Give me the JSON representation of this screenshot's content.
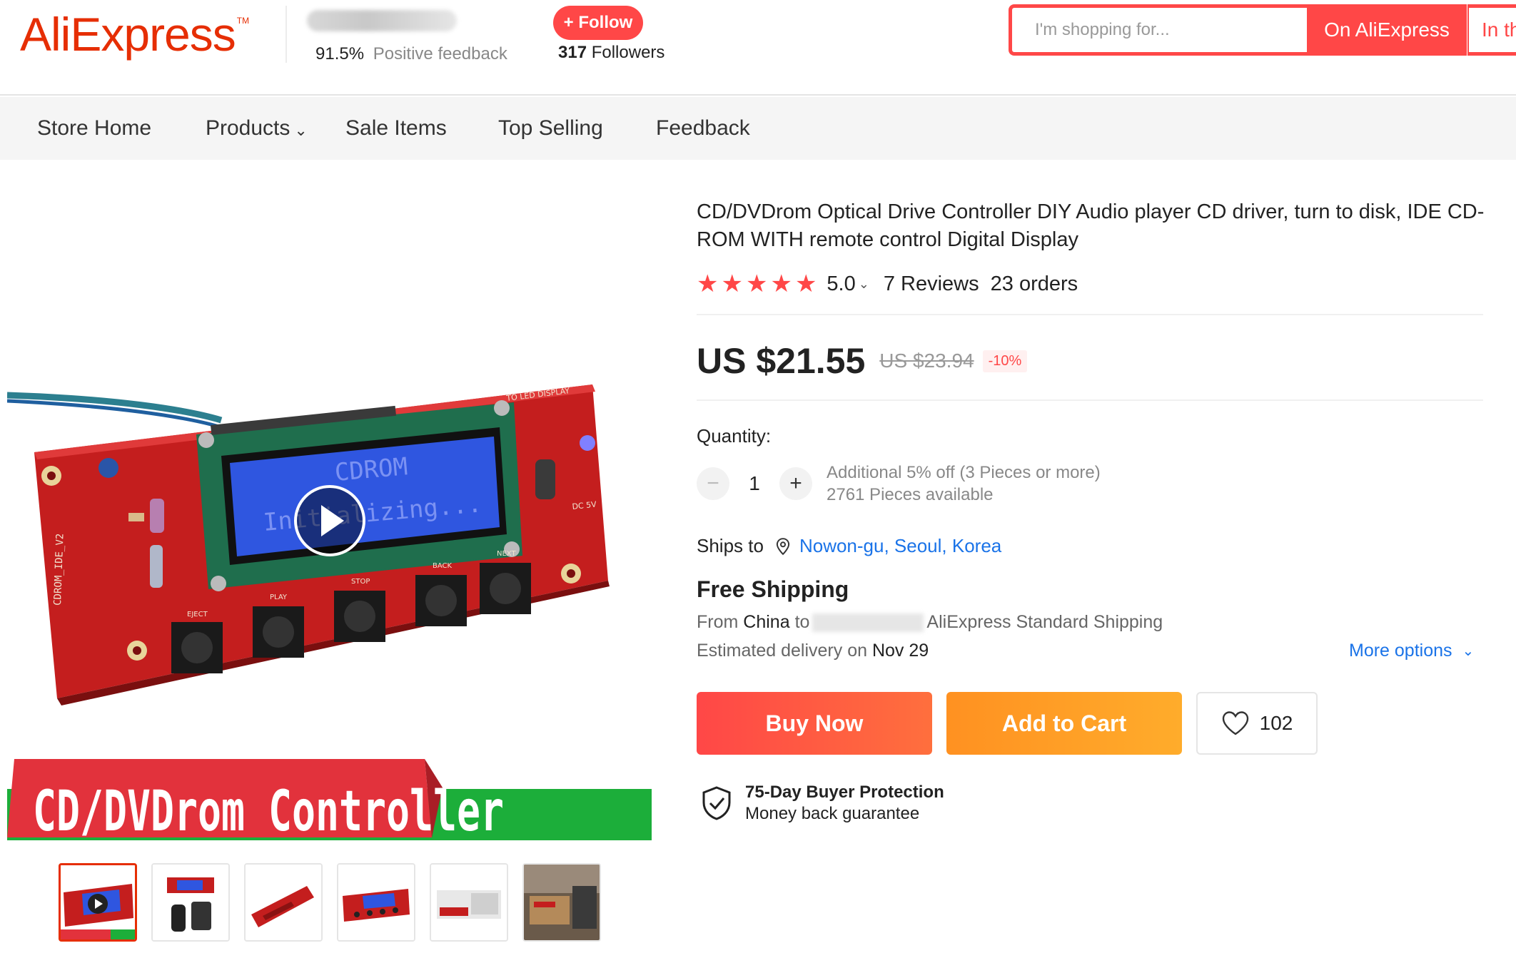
{
  "header": {
    "logo": "AliExpress",
    "logo_tm": "TM",
    "store": {
      "feedback_pct": "91.5%",
      "feedback_label": "Positive feedback",
      "follow_label": "+ Follow",
      "followers_count": "317",
      "followers_label": "Followers"
    },
    "search": {
      "placeholder": "I'm shopping for...",
      "button_label": "On AliExpress",
      "button2_label": "In this store"
    }
  },
  "nav": {
    "items": [
      {
        "label": "Store Home"
      },
      {
        "label": "Products"
      },
      {
        "label": "Sale Items"
      },
      {
        "label": "Top Selling"
      },
      {
        "label": "Feedback"
      }
    ]
  },
  "gallery": {
    "banner_text": "CD/DVDrom  Controller",
    "lcd_line1": "CDROM",
    "lcd_line2": "Initializing...",
    "pcb_side_label": "CDROM_IDE_V2",
    "pcb_top_label": "TO LED DISPLAY",
    "pcb_power_label": "DC 5V",
    "button_labels": [
      "EJECT",
      "PLAY",
      "STOP",
      "BACK",
      "NEXT"
    ],
    "thumbnail_count": 6,
    "active_thumbnail": 0
  },
  "product": {
    "title": "CD/DVDrom Optical Drive Controller DIY Audio player CD driver, turn to disk, IDE CD-ROM WITH remote control Digital Display",
    "rating": "5.0",
    "stars": 5,
    "reviews": "7 Reviews",
    "orders": "23 orders",
    "price": "US $21.55",
    "old_price": "US $23.94",
    "discount": "-10%",
    "quantity_label": "Quantity:",
    "quantity_value": "1",
    "qty_minus": "−",
    "qty_plus": "+",
    "bulk_offer": "Additional 5% off (3 Pieces or more)",
    "available": "2761 Pieces available",
    "ships_to_label": "Ships to",
    "ships_to_location": "Nowon-gu, Seoul, Korea",
    "shipping_title": "Free Shipping",
    "from_label": "From",
    "from_country": "China",
    "to_label": "to",
    "shipping_method": "AliExpress Standard Shipping",
    "est_delivery_label": "Estimated delivery",
    "est_on": "on",
    "est_date": "Nov 29",
    "more_options": "More options",
    "buy_now": "Buy Now",
    "add_to_cart": "Add to Cart",
    "wishlist_count": "102",
    "protection_title": "75-Day Buyer Protection",
    "protection_sub": "Money back guarantee"
  },
  "colors": {
    "brand": "#e62e04",
    "accent": "#ff4747",
    "cart": "#ff9121",
    "link": "#1a73e8"
  }
}
